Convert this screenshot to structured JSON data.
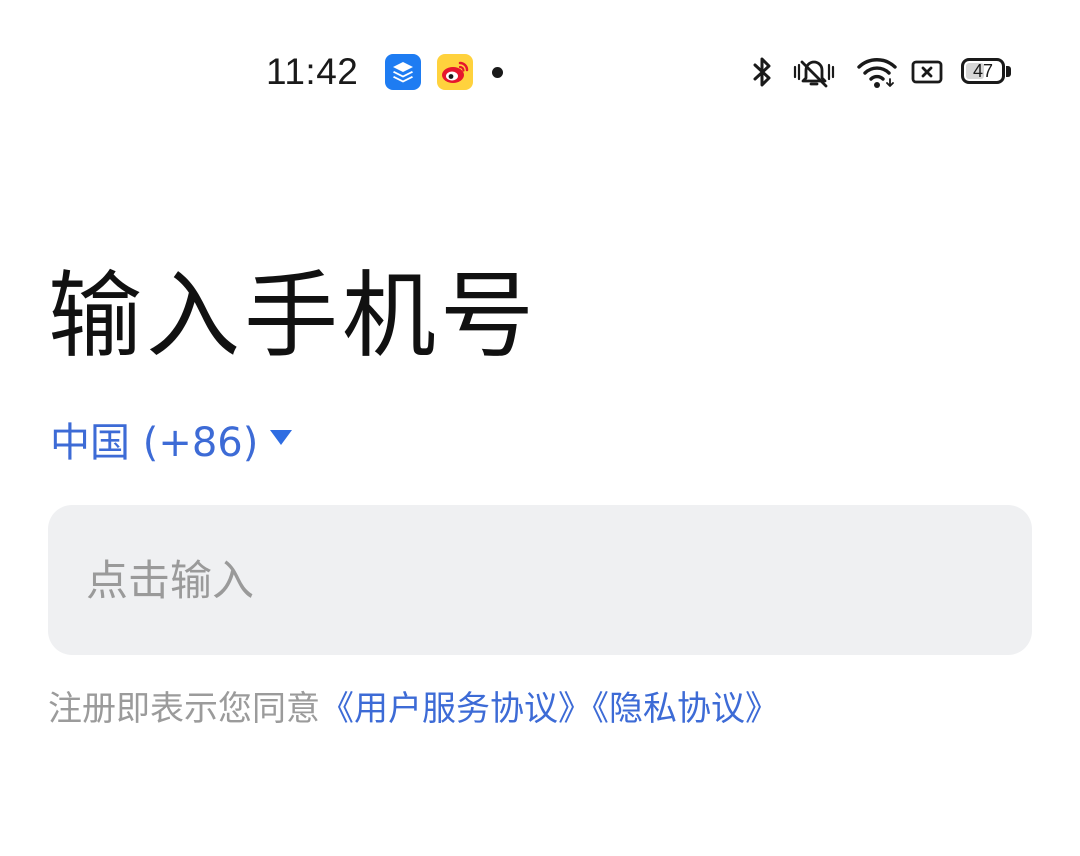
{
  "status_bar": {
    "time": "11:42",
    "battery_level": "47",
    "icons": [
      "layers-app-icon",
      "weibo-app-icon",
      "notification-dot",
      "bluetooth-icon",
      "vibrate-icon",
      "wifi-icon",
      "no-sim-icon",
      "battery-icon"
    ],
    "colors": {
      "layers_app": "#1e7cf2",
      "weibo_app": "#ffd23d"
    }
  },
  "main": {
    "title": "输入手机号",
    "country_selector": {
      "label": "中国 (+86)"
    },
    "phone_input": {
      "value": "",
      "placeholder": "点击输入"
    },
    "agreement": {
      "prefix": "注册即表示您同意",
      "user_agreement": "《用户服务协议》",
      "privacy_policy": "《隐私协议》"
    }
  },
  "colors": {
    "accent": "#3d6bd6",
    "input_bg": "#eff0f2",
    "muted_text": "#9b9b9b"
  }
}
